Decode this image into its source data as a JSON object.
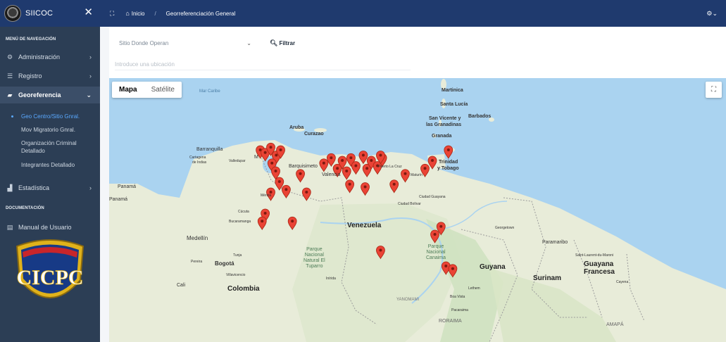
{
  "app": {
    "title": "SIICOC"
  },
  "sidebar": {
    "section_nav": "MENÚ DE NAVEGACIÓN",
    "section_doc": "DOCUMENTACIÓN",
    "items": [
      {
        "label": "Administración",
        "icon": "gear-icon"
      },
      {
        "label": "Registro",
        "icon": "list-icon"
      },
      {
        "label": "Georeferencia",
        "icon": "map-icon"
      },
      {
        "label": "Estadística",
        "icon": "bar-chart-icon"
      },
      {
        "label": "Manual de Usuario",
        "icon": "document-icon"
      }
    ],
    "subitems": [
      {
        "label": "Geo Centro/Sitio Gnral."
      },
      {
        "label": "Mov Migratorio Gnral."
      },
      {
        "label": "Organización Criminal"
      },
      {
        "label": "Detallado"
      },
      {
        "label": "Integrantes Detallado"
      }
    ],
    "emblem_text": "CICPC"
  },
  "topbar": {
    "home_label": "Inicio",
    "page_title": "Georreferenciación General"
  },
  "filter": {
    "select_value": "Sitio Donde Operan",
    "button_label": "Filtrar",
    "location_placeholder": "Introduce una ubicación"
  },
  "map": {
    "tabs": [
      "Mapa",
      "Satélite"
    ],
    "labels": {
      "mar_caribe": "Mar Caribe",
      "martinica": "Martinica",
      "santa_lucia": "Santa Lucía",
      "san_vicente": "San Vicente y",
      "granadinas": "las Granadinas",
      "barbados": "Barbados",
      "granada": "Granada",
      "trinidad": "Trinidad",
      "tobago": "y Tobago",
      "aruba": "Aruba",
      "curazao": "Curazao",
      "barranquilla": "Barranquilla",
      "cartagena": "Cartagena",
      "de_indias": "de Indias",
      "valledupar": "Valledupar",
      "maracaibo_m": "M",
      "barquisimeto": "Barquisimeto",
      "valencia": "Valencia",
      "puerto_la_cruz": "Puerto La Cruz",
      "maturin": "Maturín",
      "panama1": "Panamá",
      "panama2": "Panamá",
      "merida": "Mérida",
      "cucuta": "Cúcuta",
      "bucaramanga": "Bucaramanga",
      "ciudad_bolivar": "Ciudad Bolívar",
      "ciudad_guayana": "Ciudad Guayana",
      "venezuela": "Venezuela",
      "georgetown": "Georgetown",
      "paramaribo": "Paramaribo",
      "medellin": "Medellín",
      "bogota": "Bogotá",
      "colombia": "Colombia",
      "guyana": "Guyana",
      "surinam": "Surinam",
      "saint_laurent": "Saint-Laurent-du-Maroni",
      "guayana_francesa": "Guayana",
      "francesa": "Francesa",
      "cayenne": "Cayena",
      "parque_tuparro": "Parque\nNacional\nNatural El\nTuparro",
      "parque_canaima": "Parque\nNacional\nCanaima",
      "yanomami": "YANOMAMI",
      "roraima": "RORAIMA",
      "boa_vista": "Boa Vista",
      "amapa": "AMAPÁ",
      "cali": "Cali",
      "pereira": "Pereira",
      "tunja": "Tunja",
      "villavicencio": "Villavicencio",
      "inirida": "Inírida",
      "lethem": "Lethem",
      "pacaraima": "Pacaraima"
    },
    "pins": [
      [
        0.245,
        0.28
      ],
      [
        0.253,
        0.29
      ],
      [
        0.262,
        0.27
      ],
      [
        0.271,
        0.3
      ],
      [
        0.278,
        0.28
      ],
      [
        0.264,
        0.33
      ],
      [
        0.27,
        0.36
      ],
      [
        0.276,
        0.4
      ],
      [
        0.287,
        0.43
      ],
      [
        0.262,
        0.44
      ],
      [
        0.253,
        0.52
      ],
      [
        0.248,
        0.55
      ],
      [
        0.32,
        0.44
      ],
      [
        0.31,
        0.37
      ],
      [
        0.297,
        0.55
      ],
      [
        0.348,
        0.33
      ],
      [
        0.36,
        0.31
      ],
      [
        0.37,
        0.35
      ],
      [
        0.378,
        0.32
      ],
      [
        0.385,
        0.36
      ],
      [
        0.392,
        0.31
      ],
      [
        0.4,
        0.34
      ],
      [
        0.412,
        0.3
      ],
      [
        0.418,
        0.35
      ],
      [
        0.425,
        0.32
      ],
      [
        0.435,
        0.34
      ],
      [
        0.443,
        0.31
      ],
      [
        0.39,
        0.41
      ],
      [
        0.415,
        0.42
      ],
      [
        0.44,
        0.3
      ],
      [
        0.462,
        0.41
      ],
      [
        0.48,
        0.37
      ],
      [
        0.512,
        0.35
      ],
      [
        0.524,
        0.32
      ],
      [
        0.55,
        0.28
      ],
      [
        0.44,
        0.66
      ],
      [
        0.528,
        0.6
      ],
      [
        0.538,
        0.57
      ],
      [
        0.546,
        0.72
      ],
      [
        0.557,
        0.73
      ]
    ]
  }
}
